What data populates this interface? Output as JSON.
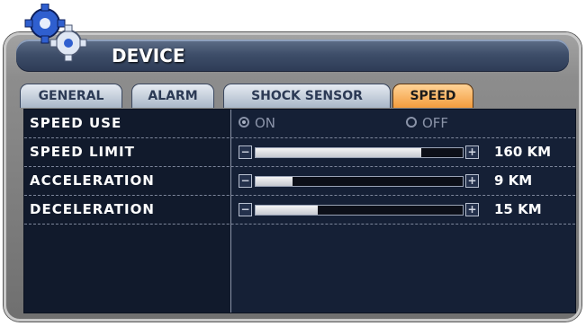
{
  "window": {
    "title": "DEVICE"
  },
  "tabs": [
    {
      "label": "GENERAL",
      "active": false
    },
    {
      "label": "ALARM",
      "active": false
    },
    {
      "label": "SHOCK SENSOR",
      "active": false
    },
    {
      "label": "SPEED",
      "active": true
    }
  ],
  "rows": {
    "speed_use": {
      "label": "SPEED USE",
      "on_label": "ON",
      "off_label": "OFF",
      "selected": "ON"
    },
    "speed_limit": {
      "label": "SPEED LIMIT",
      "value": "160 KM",
      "fraction": 0.8
    },
    "acceleration": {
      "label": "ACCELERATION",
      "value": "9 KM",
      "fraction": 0.18
    },
    "deceleration": {
      "label": "DECELERATION",
      "value": "15 KM",
      "fraction": 0.3
    }
  },
  "colors": {
    "active_tab": "#f39c3d",
    "panel": "#152036"
  }
}
